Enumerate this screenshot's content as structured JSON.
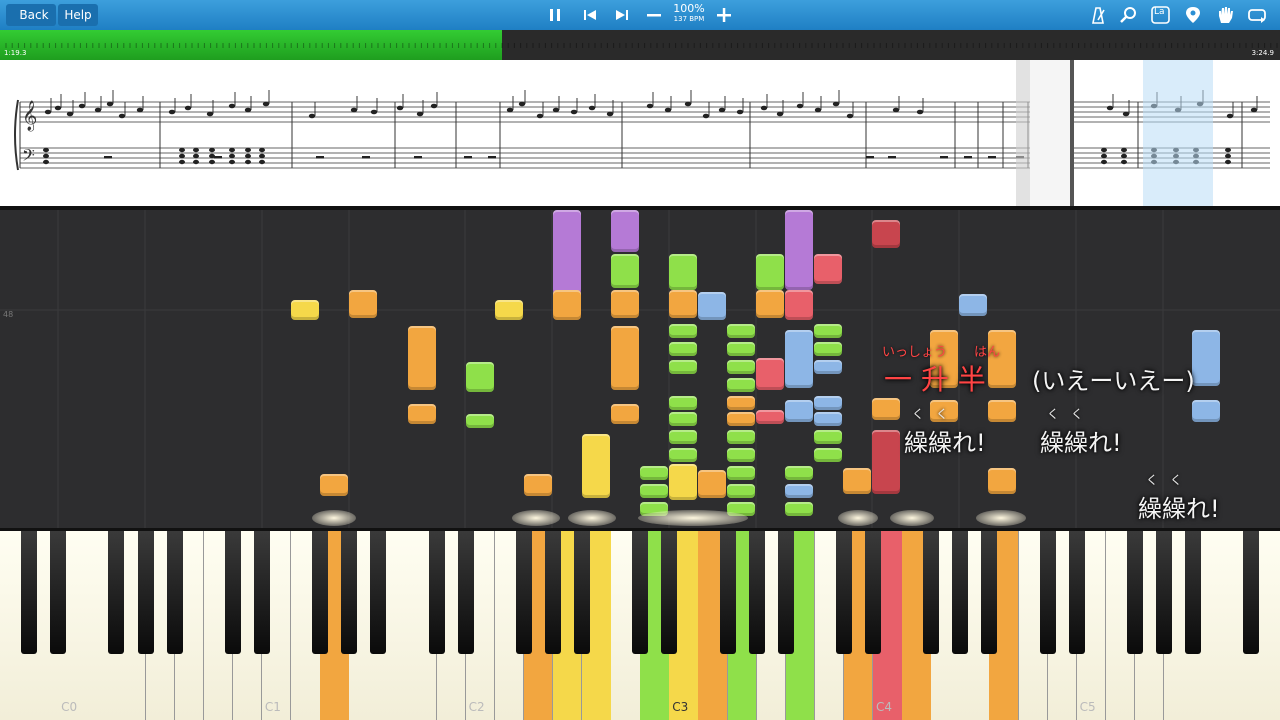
{
  "toolbar": {
    "back_label": "Back",
    "help_label": "Help",
    "zoom_percent": "100%",
    "tempo": "137 BPM",
    "icons": [
      "pause-icon",
      "skip-back-icon",
      "skip-forward-icon",
      "minus-icon",
      "plus-icon",
      "metronome-icon",
      "search-icon",
      "note-label-icon",
      "location-pin-icon",
      "hand-icon",
      "loop-icon"
    ],
    "note_label_text": "La"
  },
  "progress": {
    "elapsed": "1:19.3",
    "total": "3:24.9",
    "fraction": 0.392
  },
  "pianoroll": {
    "measure_number": "48"
  },
  "keyboard": {
    "labels": [
      "C0",
      "C1",
      "C2",
      "C3",
      "C4",
      "C5"
    ]
  },
  "lyrics": {
    "line1_main": "一 升 半",
    "line1_furigana_a": "いっしょう",
    "line1_furigana_b": "はん",
    "line1_paren": "(いえーいえー)",
    "line2_a": "繰繰れ!",
    "line2_b": "繰繰れ!",
    "line2_furi_a": "く　く",
    "line2_furi_b": "く　く",
    "line3": "繰繰れ!",
    "line3_furi": "く　く"
  },
  "colors": {
    "toolbar": "#2a8fd4",
    "progress_fill": "#2bb52b",
    "orange": "#f2a640",
    "yellow": "#f5d84a",
    "green": "#8fe04a",
    "blue": "#8db6e6",
    "red": "#e8606a",
    "purple": "#b57ad6",
    "darkred": "#c8454e"
  }
}
